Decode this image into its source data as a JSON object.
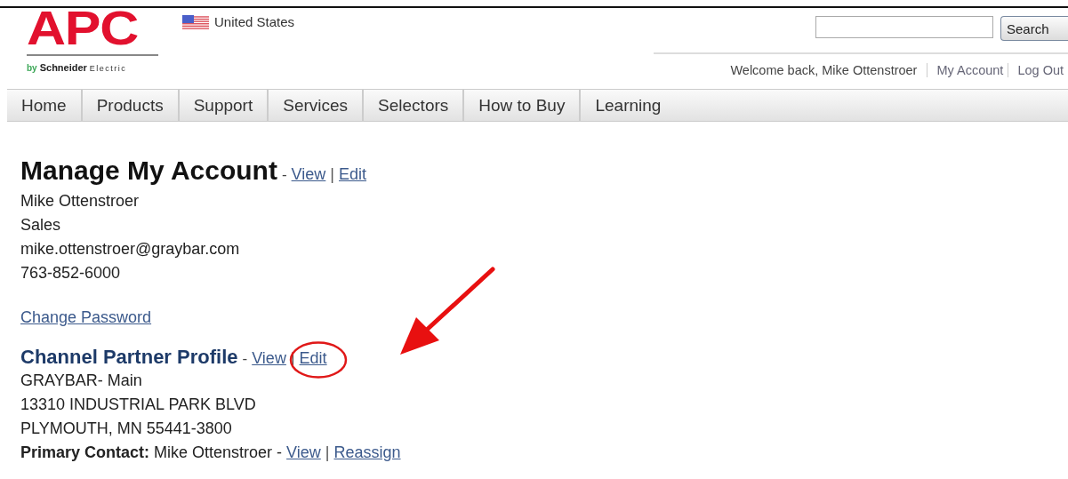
{
  "header": {
    "logo": {
      "wordmark": "APC",
      "tagline_prefix": "by",
      "tagline_brand": "Schneider",
      "tagline_suffix": "Electric"
    },
    "country": "United States",
    "search": {
      "button": "Search"
    },
    "user_bar": {
      "welcome": "Welcome back,  Mike Ottenstroer",
      "links": [
        "My Account",
        "Log Out"
      ]
    }
  },
  "nav": [
    {
      "label": "Home"
    },
    {
      "label": "Products"
    },
    {
      "label": "Support"
    },
    {
      "label": "Services"
    },
    {
      "label": "Selectors"
    },
    {
      "label": "How to Buy"
    },
    {
      "label": "Learning"
    }
  ],
  "account": {
    "title": "Manage My Account",
    "separator": "-",
    "divider": "|",
    "actions": [
      {
        "label": "View"
      },
      {
        "label": "Edit"
      }
    ],
    "lines": [
      "Mike Ottenstroer",
      "Sales",
      "mike.ottenstroer@graybar.com",
      "763-852-6000"
    ],
    "change_password": "Change Password"
  },
  "profile": {
    "title": "Channel Partner Profile",
    "separator": "-",
    "divider": "|",
    "actions": [
      {
        "label": "View",
        "circled": false
      },
      {
        "label": "Edit",
        "circled": true
      }
    ],
    "lines": [
      "GRAYBAR- Main",
      "13310 INDUSTRIAL PARK BLVD",
      "PLYMOUTH, MN 55441-3800"
    ],
    "contact": {
      "label": "Primary Contact:",
      "value": "Mike Ottenstroer -",
      "divider": "|",
      "actions": [
        "View",
        "Reassign"
      ]
    }
  },
  "annotations": [
    {
      "kind": "arrow"
    }
  ]
}
